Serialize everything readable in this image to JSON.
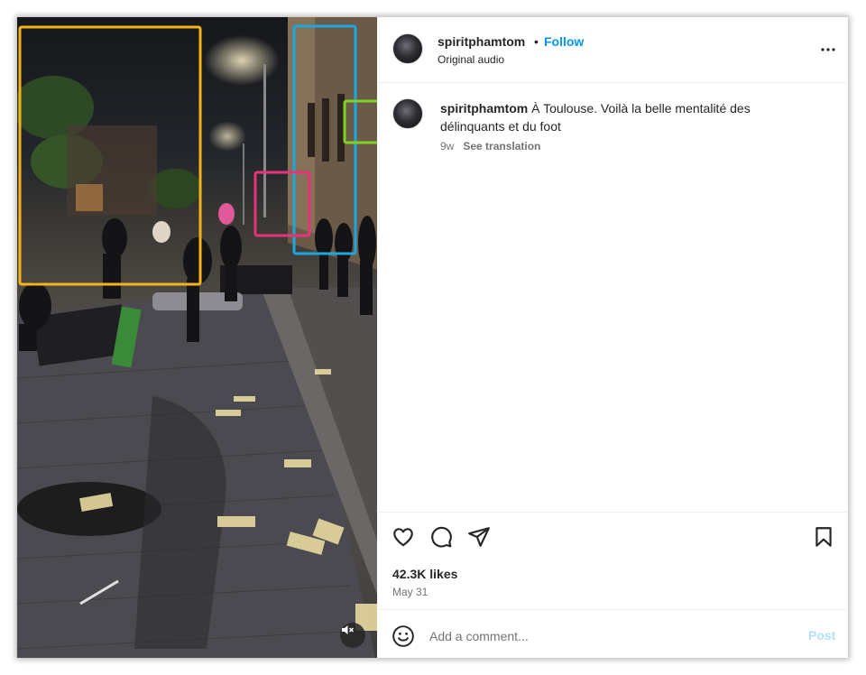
{
  "post": {
    "username": "spiritphamtom",
    "separator": "•",
    "follow_label": "Follow",
    "audio_label": "Original audio",
    "more_icon": "more-horizontal-icon"
  },
  "caption": {
    "username": "spiritphamtom",
    "text": "À Toulouse. Voilà la belle mentalité des délinquants et du foot",
    "age": "9w",
    "see_translation": "See translation"
  },
  "actions": {
    "icons": [
      "heart-icon",
      "comment-icon",
      "share-icon",
      "bookmark-icon"
    ],
    "likes": "42.3K likes",
    "date": "May 31"
  },
  "comment_box": {
    "placeholder": "Add a comment...",
    "post_label": "Post",
    "emoji_icon": "emoji-icon"
  },
  "media": {
    "mute_icon": "muted-speaker-icon",
    "annotation_colors": {
      "orange": "#f6b21b",
      "blue": "#1ea7dc",
      "green": "#7ed321",
      "pink": "#e8337a"
    }
  },
  "colors": {
    "accent": "#0095f6",
    "post_disabled": "#b2dffc",
    "secondary_text": "#737373"
  }
}
